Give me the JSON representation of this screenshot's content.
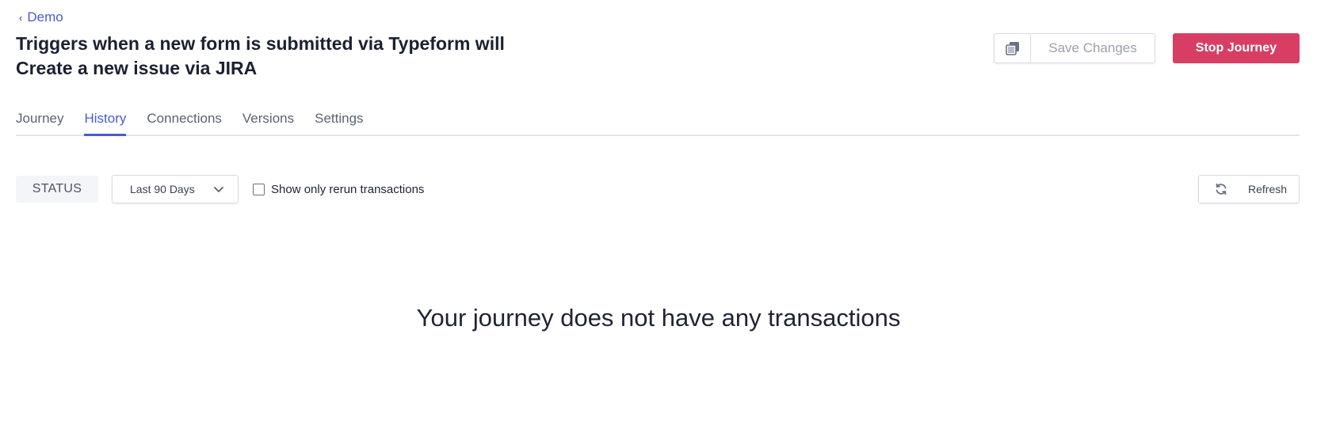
{
  "breadcrumb": {
    "back_label": "Demo"
  },
  "page": {
    "title_line1": "Triggers when a new form is submitted via Typeform will",
    "title_line2": "Create a new issue via JIRA"
  },
  "actions": {
    "save_label": "Save Changes",
    "stop_label": "Stop Journey",
    "stop_color": "#d83e64"
  },
  "tabs": [
    {
      "label": "Journey",
      "active": false
    },
    {
      "label": "History",
      "active": true
    },
    {
      "label": "Connections",
      "active": false
    },
    {
      "label": "Versions",
      "active": false
    },
    {
      "label": "Settings",
      "active": false
    }
  ],
  "filters": {
    "status_label": "STATUS",
    "date_range": "Last 90 Days",
    "rerun_label": "Show only rerun transactions",
    "rerun_checked": false,
    "refresh_label": "Refresh"
  },
  "empty_state": {
    "message": "Your journey does not have any transactions"
  },
  "colors": {
    "accent": "#4a5bd4",
    "danger": "#d83e64"
  }
}
